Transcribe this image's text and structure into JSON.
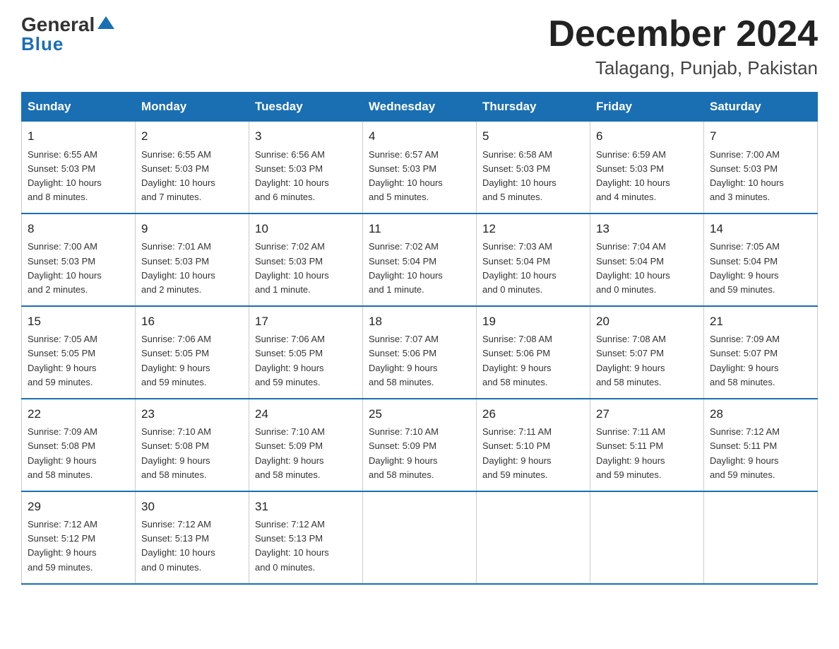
{
  "logo": {
    "general": "General",
    "blue": "Blue"
  },
  "title": "December 2024",
  "subtitle": "Talagang, Punjab, Pakistan",
  "days_of_week": [
    "Sunday",
    "Monday",
    "Tuesday",
    "Wednesday",
    "Thursday",
    "Friday",
    "Saturday"
  ],
  "weeks": [
    [
      {
        "day": "1",
        "info": "Sunrise: 6:55 AM\nSunset: 5:03 PM\nDaylight: 10 hours\nand 8 minutes."
      },
      {
        "day": "2",
        "info": "Sunrise: 6:55 AM\nSunset: 5:03 PM\nDaylight: 10 hours\nand 7 minutes."
      },
      {
        "day": "3",
        "info": "Sunrise: 6:56 AM\nSunset: 5:03 PM\nDaylight: 10 hours\nand 6 minutes."
      },
      {
        "day": "4",
        "info": "Sunrise: 6:57 AM\nSunset: 5:03 PM\nDaylight: 10 hours\nand 5 minutes."
      },
      {
        "day": "5",
        "info": "Sunrise: 6:58 AM\nSunset: 5:03 PM\nDaylight: 10 hours\nand 5 minutes."
      },
      {
        "day": "6",
        "info": "Sunrise: 6:59 AM\nSunset: 5:03 PM\nDaylight: 10 hours\nand 4 minutes."
      },
      {
        "day": "7",
        "info": "Sunrise: 7:00 AM\nSunset: 5:03 PM\nDaylight: 10 hours\nand 3 minutes."
      }
    ],
    [
      {
        "day": "8",
        "info": "Sunrise: 7:00 AM\nSunset: 5:03 PM\nDaylight: 10 hours\nand 2 minutes."
      },
      {
        "day": "9",
        "info": "Sunrise: 7:01 AM\nSunset: 5:03 PM\nDaylight: 10 hours\nand 2 minutes."
      },
      {
        "day": "10",
        "info": "Sunrise: 7:02 AM\nSunset: 5:03 PM\nDaylight: 10 hours\nand 1 minute."
      },
      {
        "day": "11",
        "info": "Sunrise: 7:02 AM\nSunset: 5:04 PM\nDaylight: 10 hours\nand 1 minute."
      },
      {
        "day": "12",
        "info": "Sunrise: 7:03 AM\nSunset: 5:04 PM\nDaylight: 10 hours\nand 0 minutes."
      },
      {
        "day": "13",
        "info": "Sunrise: 7:04 AM\nSunset: 5:04 PM\nDaylight: 10 hours\nand 0 minutes."
      },
      {
        "day": "14",
        "info": "Sunrise: 7:05 AM\nSunset: 5:04 PM\nDaylight: 9 hours\nand 59 minutes."
      }
    ],
    [
      {
        "day": "15",
        "info": "Sunrise: 7:05 AM\nSunset: 5:05 PM\nDaylight: 9 hours\nand 59 minutes."
      },
      {
        "day": "16",
        "info": "Sunrise: 7:06 AM\nSunset: 5:05 PM\nDaylight: 9 hours\nand 59 minutes."
      },
      {
        "day": "17",
        "info": "Sunrise: 7:06 AM\nSunset: 5:05 PM\nDaylight: 9 hours\nand 59 minutes."
      },
      {
        "day": "18",
        "info": "Sunrise: 7:07 AM\nSunset: 5:06 PM\nDaylight: 9 hours\nand 58 minutes."
      },
      {
        "day": "19",
        "info": "Sunrise: 7:08 AM\nSunset: 5:06 PM\nDaylight: 9 hours\nand 58 minutes."
      },
      {
        "day": "20",
        "info": "Sunrise: 7:08 AM\nSunset: 5:07 PM\nDaylight: 9 hours\nand 58 minutes."
      },
      {
        "day": "21",
        "info": "Sunrise: 7:09 AM\nSunset: 5:07 PM\nDaylight: 9 hours\nand 58 minutes."
      }
    ],
    [
      {
        "day": "22",
        "info": "Sunrise: 7:09 AM\nSunset: 5:08 PM\nDaylight: 9 hours\nand 58 minutes."
      },
      {
        "day": "23",
        "info": "Sunrise: 7:10 AM\nSunset: 5:08 PM\nDaylight: 9 hours\nand 58 minutes."
      },
      {
        "day": "24",
        "info": "Sunrise: 7:10 AM\nSunset: 5:09 PM\nDaylight: 9 hours\nand 58 minutes."
      },
      {
        "day": "25",
        "info": "Sunrise: 7:10 AM\nSunset: 5:09 PM\nDaylight: 9 hours\nand 58 minutes."
      },
      {
        "day": "26",
        "info": "Sunrise: 7:11 AM\nSunset: 5:10 PM\nDaylight: 9 hours\nand 59 minutes."
      },
      {
        "day": "27",
        "info": "Sunrise: 7:11 AM\nSunset: 5:11 PM\nDaylight: 9 hours\nand 59 minutes."
      },
      {
        "day": "28",
        "info": "Sunrise: 7:12 AM\nSunset: 5:11 PM\nDaylight: 9 hours\nand 59 minutes."
      }
    ],
    [
      {
        "day": "29",
        "info": "Sunrise: 7:12 AM\nSunset: 5:12 PM\nDaylight: 9 hours\nand 59 minutes."
      },
      {
        "day": "30",
        "info": "Sunrise: 7:12 AM\nSunset: 5:13 PM\nDaylight: 10 hours\nand 0 minutes."
      },
      {
        "day": "31",
        "info": "Sunrise: 7:12 AM\nSunset: 5:13 PM\nDaylight: 10 hours\nand 0 minutes."
      },
      {
        "day": "",
        "info": ""
      },
      {
        "day": "",
        "info": ""
      },
      {
        "day": "",
        "info": ""
      },
      {
        "day": "",
        "info": ""
      }
    ]
  ]
}
